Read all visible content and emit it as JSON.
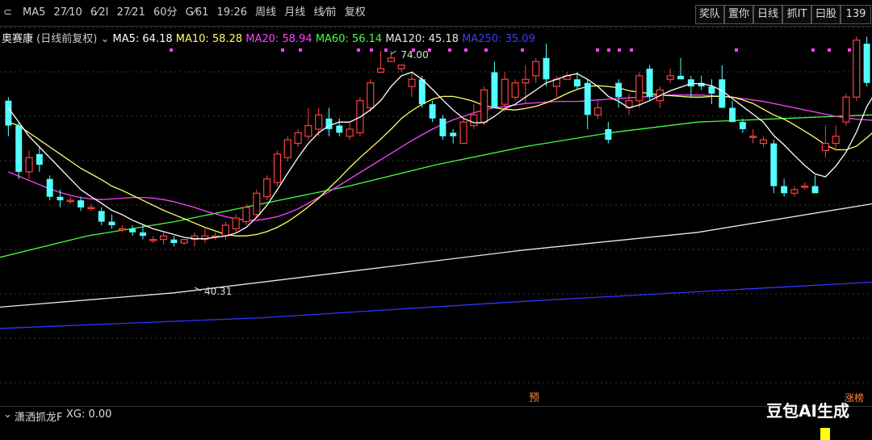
{
  "toolbar": {
    "periods": [
      "MA5",
      "27⁄10",
      "6⁄2Ι",
      "27⁄21",
      "60分",
      "G⁄61",
      "19:26",
      "周线",
      "月线",
      "线⁄前",
      "复权"
    ],
    "right_buttons": [
      "奖队",
      "置你",
      "日线",
      "抓IT",
      "曰股",
      "139"
    ]
  },
  "legend": {
    "stock": "奥赛康",
    "mode": "(日线前复权)",
    "ma5": "MA5: 64.18",
    "ma10": "MA10: 58.28",
    "ma20": "MA20: 58.94",
    "ma60": "MA60: 56.14",
    "ma120": "MA120: 45.18",
    "ma250": "MA250: 35.09"
  },
  "annotations": {
    "high": "74.00",
    "low": "40.31",
    "markers": [
      "预",
      "涨榜"
    ]
  },
  "indicator": {
    "name": "潇洒抓龙F",
    "value": "XG: 0.00"
  },
  "watermark": "豆包AI生成",
  "colors": {
    "up": "#ff4040",
    "down": "#54ffff",
    "ma5": "#ffffff",
    "ma10": "#ffff66",
    "ma20": "#ff44ff",
    "ma60": "#44ff44",
    "ma120": "#e8e8e8",
    "ma250": "#3333ff"
  },
  "chart_data": {
    "type": "candlestick",
    "ylim": [
      30,
      80
    ],
    "candles": [
      [
        67,
        67.5,
        62,
        63.5
      ],
      [
        63.5,
        64,
        56,
        57
      ],
      [
        57,
        60,
        56,
        59
      ],
      [
        59.5,
        60.5,
        57,
        58
      ],
      [
        56,
        56.5,
        53,
        53.5
      ],
      [
        53.5,
        54.5,
        52,
        53
      ],
      [
        53,
        53.5,
        52.5,
        53
      ],
      [
        53,
        53.5,
        51.5,
        52
      ],
      [
        52,
        52.5,
        51.5,
        52
      ],
      [
        51.5,
        52,
        49.5,
        50
      ],
      [
        50,
        51,
        49,
        49.5
      ],
      [
        49,
        49.5,
        48.5,
        49
      ],
      [
        49,
        49.5,
        48,
        48.5
      ],
      [
        48.5,
        49.5,
        47.5,
        48
      ],
      [
        47.5,
        48,
        47,
        47.5
      ],
      [
        47.5,
        48.5,
        46.8,
        48
      ],
      [
        47.5,
        48,
        46.5,
        47
      ],
      [
        47,
        47.5,
        46.8,
        47.5
      ],
      [
        47.5,
        48.5,
        46.5,
        48
      ],
      [
        47.5,
        49,
        47,
        48
      ],
      [
        48,
        48.5,
        47.5,
        48
      ],
      [
        48,
        50,
        47.5,
        49.5
      ],
      [
        49,
        51,
        48.5,
        50.5
      ],
      [
        50,
        52.5,
        49.5,
        52
      ],
      [
        51,
        54.5,
        50.5,
        54
      ],
      [
        53.5,
        56.5,
        53,
        56
      ],
      [
        55.5,
        60,
        55,
        59.5
      ],
      [
        59,
        62,
        58.5,
        61.5
      ],
      [
        61,
        63,
        60.5,
        62.5
      ],
      [
        62,
        66,
        61.5,
        63.5
      ],
      [
        63,
        66,
        62,
        65
      ],
      [
        64.5,
        66,
        62,
        63
      ],
      [
        63.5,
        64.5,
        62,
        62.5
      ],
      [
        62,
        64,
        61.5,
        63
      ],
      [
        62.5,
        67.5,
        62,
        67
      ],
      [
        66,
        70,
        65.5,
        69.5
      ],
      [
        71,
        74,
        71,
        71.5
      ],
      [
        72.5,
        74,
        72.5,
        73
      ],
      [
        71.5,
        72,
        71,
        72
      ],
      [
        69,
        71,
        67.5,
        70
      ],
      [
        70,
        70.5,
        66,
        66.5
      ],
      [
        66.5,
        67,
        64,
        64.5
      ],
      [
        64.5,
        65,
        61.5,
        62
      ],
      [
        62.5,
        63,
        61,
        62
      ],
      [
        61,
        64.5,
        61,
        64
      ],
      [
        63.5,
        66.5,
        63,
        65
      ],
      [
        64,
        69,
        63.5,
        68.5
      ],
      [
        71,
        72.5,
        66,
        66
      ],
      [
        66.5,
        71,
        65.5,
        70
      ],
      [
        67.5,
        70,
        67,
        69.5
      ],
      [
        69.5,
        72,
        66.5,
        70
      ],
      [
        70.5,
        73,
        69.5,
        72.5
      ],
      [
        73,
        75,
        69,
        70
      ],
      [
        69,
        70.5,
        67.5,
        70
      ],
      [
        70,
        71,
        70,
        70.5
      ],
      [
        70,
        71,
        68.5,
        69
      ],
      [
        69.5,
        70,
        63,
        65
      ],
      [
        65,
        67,
        64.5,
        66
      ],
      [
        63,
        64,
        61,
        61.5
      ],
      [
        69.5,
        70,
        66,
        67.5
      ],
      [
        66,
        68,
        65,
        67
      ],
      [
        67,
        71,
        66,
        70.5
      ],
      [
        71.5,
        72,
        67,
        67.5
      ],
      [
        67,
        69,
        66,
        68.5
      ],
      [
        70,
        71.5,
        69.5,
        70.5
      ],
      [
        70.5,
        73,
        70,
        70
      ],
      [
        70,
        70.5,
        67.5,
        69
      ],
      [
        69.5,
        70.5,
        68.5,
        69
      ],
      [
        69,
        70,
        66.5,
        68
      ],
      [
        70,
        72,
        66,
        66
      ],
      [
        66,
        67,
        64,
        64
      ],
      [
        64,
        64.5,
        62.5,
        63
      ],
      [
        62,
        63,
        61,
        62
      ],
      [
        61,
        62,
        60.5,
        61.5
      ],
      [
        61,
        61.5,
        54,
        55
      ],
      [
        55,
        56,
        53.5,
        54
      ],
      [
        54,
        55,
        53.5,
        54.5
      ],
      [
        55,
        55.5,
        54.5,
        55
      ],
      [
        55,
        56.5,
        54,
        54
      ],
      [
        60,
        63.5,
        59,
        61
      ],
      [
        61,
        63.5,
        60,
        62
      ],
      [
        64,
        68,
        63.5,
        67.5
      ],
      [
        67.5,
        76,
        67,
        75.5
      ],
      [
        75,
        76,
        69,
        69.5
      ]
    ],
    "ma": {
      "ma5": [
        66,
        64,
        62,
        60.5,
        59,
        57.5,
        56,
        54.5,
        53.5,
        52.6,
        51.6,
        51,
        50.2,
        49.6,
        49,
        48.6,
        48.2,
        47.8,
        47.6,
        47.6,
        47.8,
        48,
        48.4,
        49.2,
        50.6,
        52.3,
        54.5,
        56.8,
        59,
        61,
        62.5,
        63.5,
        64,
        64,
        64.7,
        65.7,
        67,
        69,
        70.5,
        71,
        70,
        68.6,
        67.1,
        65.7,
        64.5,
        63.9,
        63.9,
        64.8,
        65.9,
        66.5,
        67.5,
        68.5,
        69.5,
        70,
        70.5,
        70.8,
        70,
        69,
        67.6,
        66.9,
        66,
        66.4,
        67,
        67.7,
        68.4,
        68.9,
        69.4,
        69.4,
        69.1,
        68.4,
        67.3,
        66.2,
        65.1,
        64,
        62.1,
        60.8,
        59.3,
        57.9,
        56.7,
        56.3,
        57.8,
        59.8,
        62.6,
        66.2,
        68.5
      ]
    }
  },
  "chart_reading": {
    "ma10": [
      64,
      63.5,
      62.5,
      61.5,
      60.5,
      59.5,
      58.5,
      57.5,
      56.7,
      55.9,
      55,
      54.4,
      53.7,
      53,
      52.3,
      51.6,
      51,
      50.4,
      49.8,
      49.2,
      48.7,
      48.2,
      48,
      48,
      48.2,
      48.6,
      49.2,
      50,
      51,
      52.1,
      53.3,
      54.7,
      56.1,
      57.6,
      59,
      60.3,
      61.6,
      63,
      64.5,
      65.6,
      66.5,
      67.2,
      67.6,
      67.6,
      67.3,
      66.9,
      66.3,
      66,
      65.8,
      65.7,
      65.9,
      66.2,
      66.7,
      67.3,
      68,
      68.6,
      69,
      69.1,
      69,
      68.8,
      68.4,
      68.2,
      68,
      67.8,
      67.7,
      67.6,
      67.5,
      67.5,
      67.6,
      67.6,
      67.5,
      67.1,
      66.6,
      65.8,
      65,
      64.4,
      63.6,
      62.7,
      61.8,
      60.8,
      60.1,
      60.1,
      60.6,
      61.8,
      63.1
    ],
    "ma20": [
      57,
      56.4,
      55.8,
      55.2,
      54.6,
      54.1,
      53.7,
      53.4,
      53.2,
      53.1,
      53.2,
      53.3,
      53.4,
      53.4,
      53.3,
      53.1,
      52.8,
      52.4,
      52,
      51.5,
      51.1,
      50.7,
      50.4,
      50.2,
      50.2,
      50.4,
      50.7,
      51.2,
      51.8,
      52.6,
      53.4,
      54.2,
      55.1,
      56,
      56.9,
      57.8,
      58.7,
      59.6,
      60.5,
      61.4,
      62.2,
      63,
      63.7,
      64.3,
      64.8,
      65.3,
      65.7,
      66,
      66.2,
      66.4,
      66.6,
      66.7,
      66.8,
      66.9,
      66.9,
      66.9,
      67,
      67.1,
      67.2,
      67.3,
      67.4,
      67.5,
      67.6,
      67.7,
      67.8,
      67.8,
      67.8,
      67.8,
      67.7,
      67.6,
      67.5,
      67.3,
      67.1,
      66.9,
      66.6,
      66.3,
      66,
      65.7,
      65.4,
      65.1,
      64.8,
      64.6,
      64.4,
      64.3,
      64.2
    ],
    "ma60": [
      [
        0,
        45
      ],
      [
        0.1,
        48
      ],
      [
        0.2,
        50
      ],
      [
        0.3,
        52.5
      ],
      [
        0.4,
        55
      ],
      [
        0.5,
        58
      ],
      [
        0.6,
        60.5
      ],
      [
        0.7,
        62.5
      ],
      [
        0.8,
        64
      ],
      [
        0.9,
        64.5
      ],
      [
        1.0,
        65
      ]
    ],
    "ma120": [
      [
        0,
        38
      ],
      [
        0.2,
        40
      ],
      [
        0.4,
        43
      ],
      [
        0.6,
        46
      ],
      [
        0.8,
        48.5
      ],
      [
        1.0,
        52.5
      ]
    ],
    "ma250": [
      [
        0,
        35
      ],
      [
        0.3,
        36.5
      ],
      [
        0.6,
        38.8
      ],
      [
        0.85,
        40.5
      ],
      [
        1.0,
        41.5
      ]
    ]
  }
}
